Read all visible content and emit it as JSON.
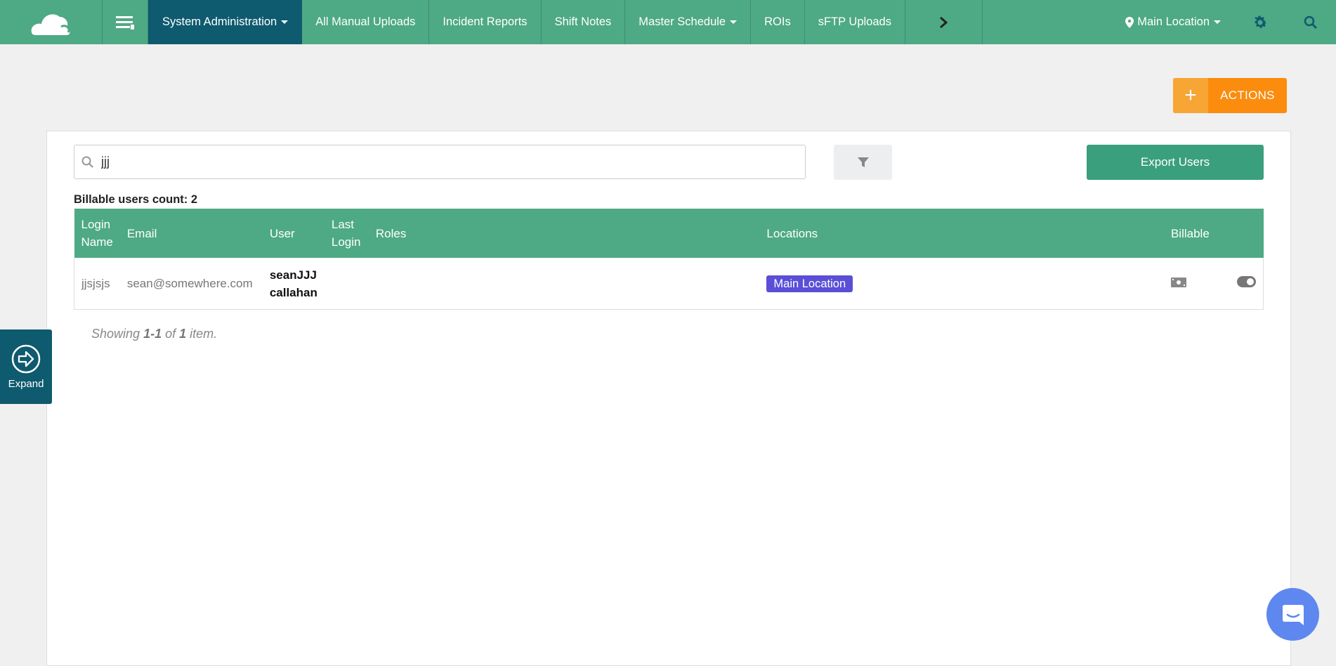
{
  "nav": {
    "items": [
      {
        "label": "System Administration",
        "dropdown": true,
        "active": true
      },
      {
        "label": "All Manual Uploads"
      },
      {
        "label": "Incident Reports"
      },
      {
        "label": "Shift Notes"
      },
      {
        "label": "Master Schedule",
        "dropdown": true
      },
      {
        "label": "ROIs"
      },
      {
        "label": "sFTP Uploads"
      }
    ],
    "location": "Main Location"
  },
  "actions": {
    "label": "ACTIONS"
  },
  "search": {
    "value": "jjj"
  },
  "export_label": "Export Users",
  "billable_count": "Billable users count: 2",
  "table": {
    "headers": [
      "Login Name",
      "Email",
      "User",
      "Last Login",
      "Roles",
      "Locations",
      "Billable",
      ""
    ],
    "rows": [
      {
        "login": "jjsjsjs",
        "email": "sean@somewhere.com",
        "user_first": "seanJJJ",
        "user_last": "callahan",
        "last_login": "",
        "roles": "",
        "location": "Main Location"
      }
    ]
  },
  "summary": {
    "prefix": "Showing",
    "range": "1-1",
    "of": "of",
    "total": "1",
    "suffix": "item."
  },
  "expand_label": "Expand",
  "colors": {
    "nav": "#4ea985",
    "active": "#0e5a6e",
    "actions": "#fb8c0e",
    "badge": "#5a4fd6"
  }
}
